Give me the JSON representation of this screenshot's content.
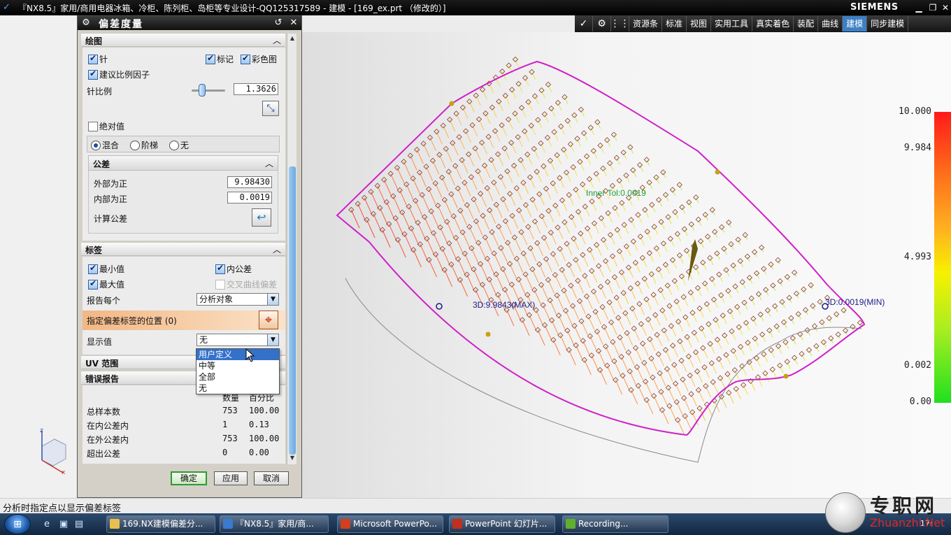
{
  "window": {
    "title": "『NX8.5』家用/商用电器冰箱、冷柜、陈列柜、岛柜等专业设计-QQ125317589 - 建模 - [169_ex.prt （修改的）]",
    "brand": "SIEMENS"
  },
  "toolbar": {
    "tabs": [
      "资源条",
      "标准",
      "视图",
      "实用工具",
      "真实着色",
      "装配",
      "曲线",
      "建模",
      "同步建模"
    ],
    "active_tab": "建模"
  },
  "dialog": {
    "title": "偏差度量",
    "drawing": {
      "header": "绘图",
      "needle": "针",
      "mark": "标记",
      "color_map": "彩色图",
      "suggest_scale": "建议比例因子",
      "needle_scale_label": "针比例",
      "needle_scale_value": "1.3626",
      "abs_value": "绝对值",
      "mode_blend": "混合",
      "mode_step": "阶梯",
      "mode_none": "无"
    },
    "tolerance": {
      "header": "公差",
      "outer_label": "外部为正",
      "outer_value": "9.98430",
      "inner_label": "内部为正",
      "inner_value": "0.0019",
      "calc_label": "计算公差"
    },
    "labels": {
      "header": "标签",
      "min": "最小值",
      "inner_tol": "内公差",
      "max": "最大值",
      "cross_curve": "交叉曲线偏差",
      "report_each_label": "报告每个",
      "report_each_value": "分析对象",
      "specify_position": "指定偏差标签的位置 (0)",
      "display_value_label": "显示值",
      "display_value": "无",
      "dropdown_options": [
        "用户定义",
        "中等",
        "全部",
        "无"
      ]
    },
    "uv_range": "UV 范围",
    "error_report": {
      "header": "错误报告",
      "col_count": "数量",
      "col_percent": "百分比",
      "rows": [
        {
          "label": "总样本数",
          "count": "753",
          "percent": "100.00"
        },
        {
          "label": "在内公差内",
          "count": "1",
          "percent": "0.13"
        },
        {
          "label": "在外公差内",
          "count": "753",
          "percent": "100.00"
        },
        {
          "label": "超出公差",
          "count": "0",
          "percent": "0.00"
        }
      ]
    },
    "buttons": {
      "ok": "确定",
      "apply": "应用",
      "cancel": "取消"
    }
  },
  "viewport": {
    "max_label": "3D:9.9843(MAX)",
    "min_label": "3D:0.0019(MIN)",
    "inner_tol_label": "Inner Tol:0.0019",
    "legend": [
      "10.000",
      "9.984",
      "4.993",
      "0.002",
      "0.00"
    ]
  },
  "status": "分析时指定点以显示偏差标签",
  "taskbar": {
    "tasks": [
      "169.NX建模偏差分...",
      "『NX8.5』家用/商...",
      "Microsoft PowerPo...",
      "PowerPoint 幻灯片...",
      "Recording..."
    ],
    "clock": "17:"
  },
  "watermark": {
    "cn": "专职网",
    "en": "Zhuanzhi.Net"
  },
  "colors": {
    "accent": "#3d7fc4",
    "boundary": "#d020c8",
    "ok_border": "#2f9a2f"
  }
}
